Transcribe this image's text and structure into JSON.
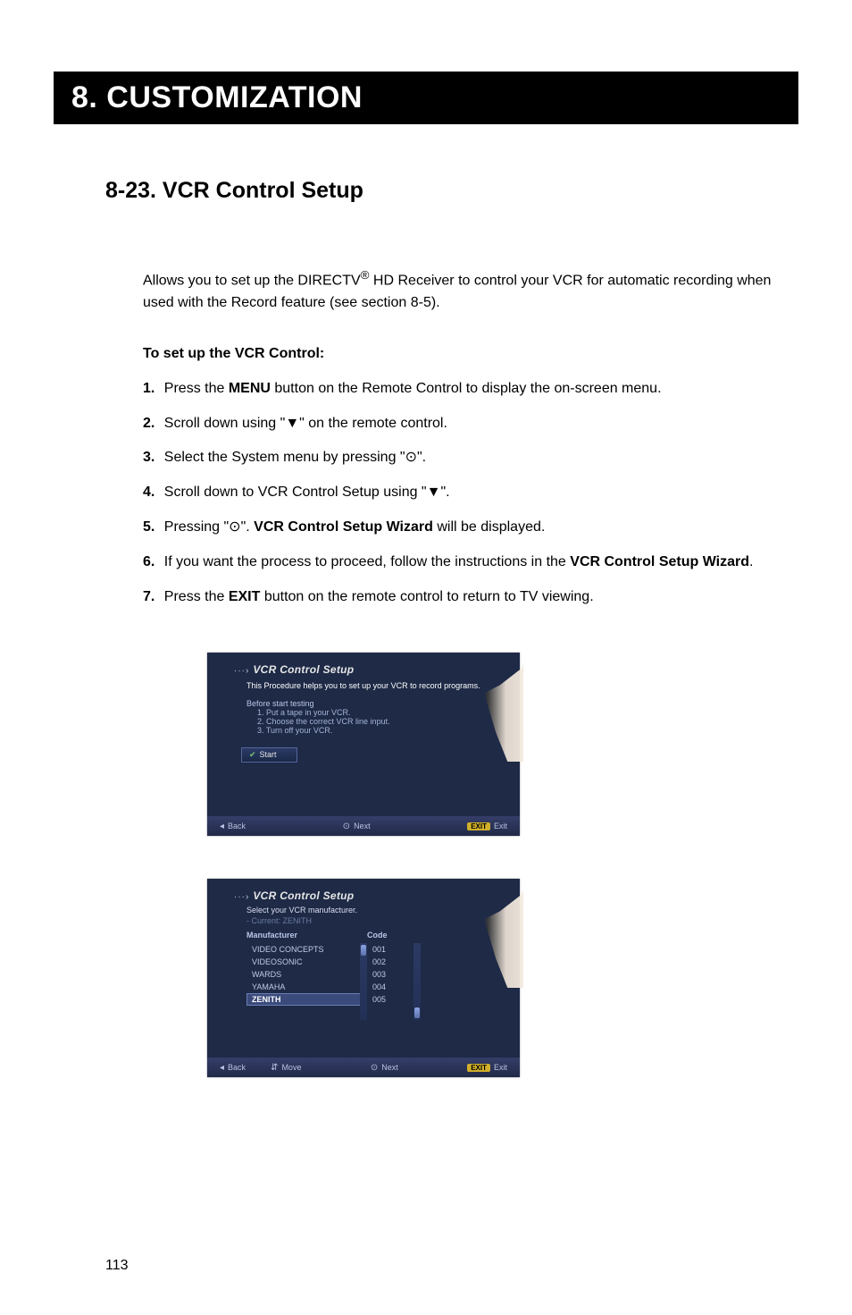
{
  "header": {
    "title": "8. CUSTOMIZATION"
  },
  "section": {
    "heading": "8-23. VCR Control Setup"
  },
  "intro": {
    "p1a": "Allows you to set up the DIRECTV",
    "reg": "®",
    "p1b": " HD Receiver to control your VCR for automatic recording when used with the Record feature (see section 8-5)."
  },
  "subhead": "To set up the VCR Control:",
  "steps": [
    {
      "n": "1.",
      "pre": " Press the ",
      "bold": "MENU",
      "post": " button on the Remote Control to display the on-screen menu."
    },
    {
      "n": "2.",
      "pre": " Scroll down using \"",
      "sym": "▼",
      "post": "\" on the remote control."
    },
    {
      "n": "3.",
      "pre": " Select the System menu by pressing \"",
      "sym": "⊙",
      "post": "\"."
    },
    {
      "n": "4.",
      "pre": " Scroll down to VCR Control Setup using \"",
      "sym": "▼",
      "post": "\"."
    },
    {
      "n": "5.",
      "pre": " Pressing \"",
      "sym": "⊙",
      "mid": "\". ",
      "bold": "VCR Control Setup Wizard",
      "post": " will be displayed."
    },
    {
      "n": "6.",
      "pre": " If you want the process to proceed, follow the instructions in the ",
      "bold": "VCR Control Setup Wizard",
      "post": "."
    },
    {
      "n": "7.",
      "pre": " Press the ",
      "bold": "EXIT",
      "post": " button on the remote control to return to TV viewing."
    }
  ],
  "shotA": {
    "breadcrumb_arrow": "···›",
    "breadcrumb": "VCR Control Setup",
    "line1": "This Procedure helps you to set up your VCR to record programs.",
    "before": "Before start testing",
    "t1": "1. Put a tape in your VCR.",
    "t2": "2. Choose the correct VCR line input.",
    "t3": "3. Turn off your VCR.",
    "start_check": "✔",
    "start_label": "Start",
    "foot_back_icon": "◂",
    "foot_back": "Back",
    "foot_next_icon": "⊙",
    "foot_next": "Next",
    "foot_exit_badge": "EXIT",
    "foot_exit": "Exit"
  },
  "shotB": {
    "breadcrumb_arrow": "···›",
    "breadcrumb": "VCR Control Setup",
    "line1": "Select your VCR manufacturer.",
    "current": "- Current: ZENITH",
    "col_mfr": "Manufacturer",
    "col_code": "Code",
    "mfrs": [
      "VIDEO CONCEPTS",
      "VIDEOSONIC",
      "WARDS",
      "YAMAHA",
      "ZENITH"
    ],
    "codes": [
      "001",
      "002",
      "003",
      "004",
      "005"
    ],
    "foot_back_icon": "◂",
    "foot_back": "Back",
    "foot_move_icon": "⇵",
    "foot_move": "Move",
    "foot_next_icon": "⊙",
    "foot_next": "Next",
    "foot_exit_badge": "EXIT",
    "foot_exit": "Exit"
  },
  "page_number": "113"
}
